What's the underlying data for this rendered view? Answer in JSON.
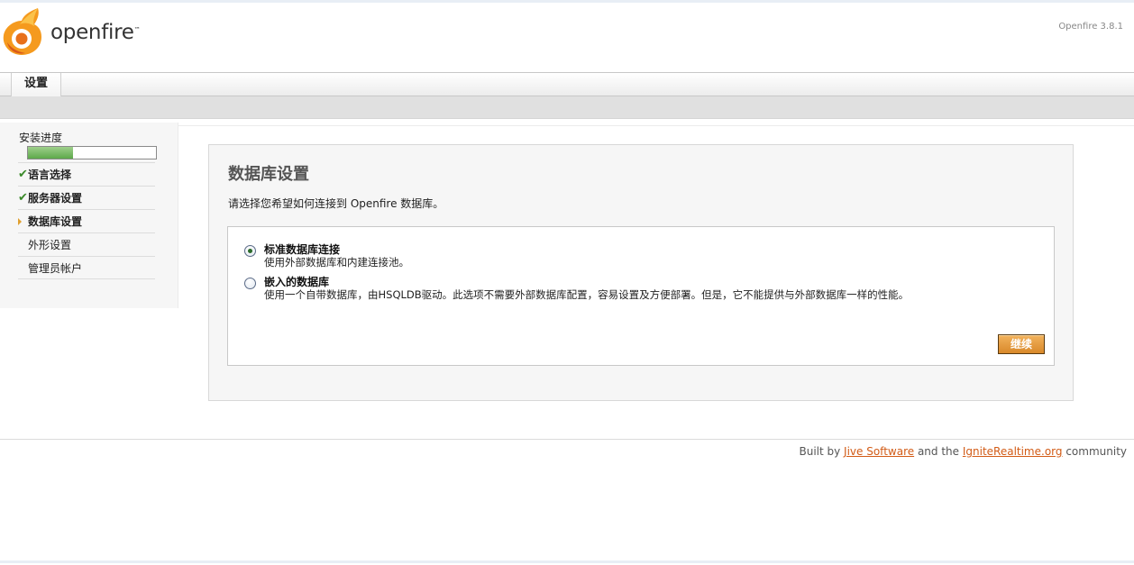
{
  "header": {
    "logo_text": "openfire",
    "logo_tm": "™",
    "version": "Openfire 3.8.1"
  },
  "tabs": [
    {
      "label": "设置"
    }
  ],
  "sidebar": {
    "progress_label": "安装进度",
    "progress": 0.35,
    "steps": [
      {
        "label": "语言选择",
        "status": "done"
      },
      {
        "label": "服务器设置",
        "status": "done"
      },
      {
        "label": "数据库设置",
        "status": "current"
      },
      {
        "label": "外形设置",
        "status": "pending"
      },
      {
        "label": "管理员帐户",
        "status": "pending"
      }
    ]
  },
  "main": {
    "title": "数据库设置",
    "description": "请选择您希望如何连接到 Openfire 数据库。",
    "options": [
      {
        "title": "标准数据库连接",
        "description": "使用外部数据库和内建连接池。",
        "selected": true
      },
      {
        "title": "嵌入的数据库",
        "description": "使用一个自带数据库，由HSQLDB驱动。此选项不需要外部数据库配置，容易设置及方便部署。但是，它不能提供与外部数据库一样的性能。",
        "selected": false
      }
    ],
    "continue_label": "继续"
  },
  "footer": {
    "prefix": "Built by ",
    "link1": "Jive Software",
    "middle": " and the ",
    "link2": "IgniteRealtime.org",
    "suffix": " community"
  },
  "colors": {
    "accent": "#d25b16",
    "progress": "#5ea84a",
    "check": "#3b8a2a"
  }
}
